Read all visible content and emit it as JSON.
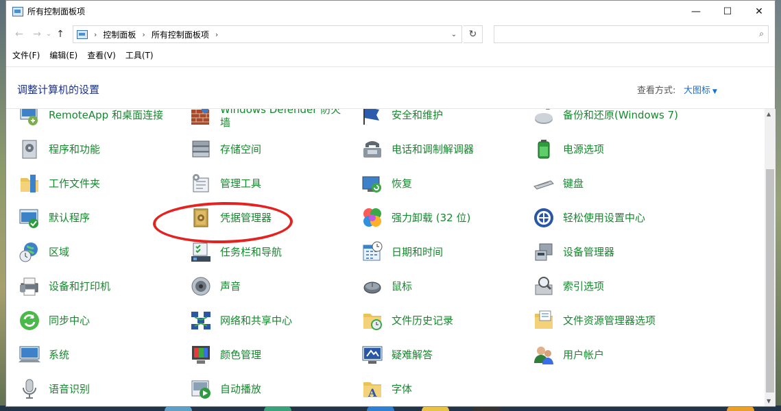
{
  "window": {
    "title": "所有控制面板项",
    "controls": {
      "minimize": "—",
      "maximize": "☐",
      "close": "✕"
    }
  },
  "nav": {
    "back": "←",
    "forward": "→",
    "recent": "⌄",
    "up": "↑",
    "breadcrumb": [
      "控制面板",
      "所有控制面板项"
    ],
    "crumb_sep": "›",
    "dropdown": "⌄",
    "refresh": "↻",
    "search_placeholder": "",
    "search_icon": "⌕"
  },
  "menu": [
    "文件(F)",
    "编辑(E)",
    "查看(V)",
    "工具(T)"
  ],
  "header": {
    "title": "调整计算机的设置",
    "view_by_label": "查看方式:",
    "view_by_value": "大图标",
    "caret": "▼"
  },
  "items": [
    {
      "label": "RemoteApp 和桌面连接",
      "icon": "remoteapp-icon"
    },
    {
      "label": "Windows Defender 防火墙",
      "icon": "firewall-icon"
    },
    {
      "label": "安全和维护",
      "icon": "security-flag-icon"
    },
    {
      "label": "备份和还原(Windows 7)",
      "icon": "backup-icon"
    },
    {
      "label": "程序和功能",
      "icon": "programs-icon"
    },
    {
      "label": "存储空间",
      "icon": "storage-icon"
    },
    {
      "label": "电话和调制解调器",
      "icon": "phone-modem-icon"
    },
    {
      "label": "电源选项",
      "icon": "power-icon"
    },
    {
      "label": "工作文件夹",
      "icon": "work-folder-icon"
    },
    {
      "label": "管理工具",
      "icon": "admin-tools-icon"
    },
    {
      "label": "恢复",
      "icon": "recovery-icon"
    },
    {
      "label": "键盘",
      "icon": "keyboard-icon"
    },
    {
      "label": "默认程序",
      "icon": "default-programs-icon"
    },
    {
      "label": "凭据管理器",
      "icon": "credential-manager-icon"
    },
    {
      "label": "强力卸载 (32 位)",
      "icon": "uninstaller-icon"
    },
    {
      "label": "轻松使用设置中心",
      "icon": "ease-of-access-icon"
    },
    {
      "label": "区域",
      "icon": "region-icon"
    },
    {
      "label": "任务栏和导航",
      "icon": "taskbar-icon"
    },
    {
      "label": "日期和时间",
      "icon": "date-time-icon"
    },
    {
      "label": "设备管理器",
      "icon": "device-manager-icon"
    },
    {
      "label": "设备和打印机",
      "icon": "printer-icon"
    },
    {
      "label": "声音",
      "icon": "sound-icon"
    },
    {
      "label": "鼠标",
      "icon": "mouse-icon"
    },
    {
      "label": "索引选项",
      "icon": "indexing-icon"
    },
    {
      "label": "同步中心",
      "icon": "sync-icon"
    },
    {
      "label": "网络和共享中心",
      "icon": "network-icon"
    },
    {
      "label": "文件历史记录",
      "icon": "file-history-icon"
    },
    {
      "label": "文件资源管理器选项",
      "icon": "explorer-options-icon"
    },
    {
      "label": "系统",
      "icon": "system-icon"
    },
    {
      "label": "颜色管理",
      "icon": "color-management-icon"
    },
    {
      "label": "疑难解答",
      "icon": "troubleshooting-icon"
    },
    {
      "label": "用户帐户",
      "icon": "user-accounts-icon"
    },
    {
      "label": "语音识别",
      "icon": "speech-icon"
    },
    {
      "label": "自动播放",
      "icon": "autoplay-icon"
    },
    {
      "label": "字体",
      "icon": "fonts-icon"
    }
  ],
  "colors": {
    "item_text": "#14892c",
    "header_title": "#1e3287",
    "link": "#1a6fc9",
    "highlight_ellipse": "#e42321"
  }
}
